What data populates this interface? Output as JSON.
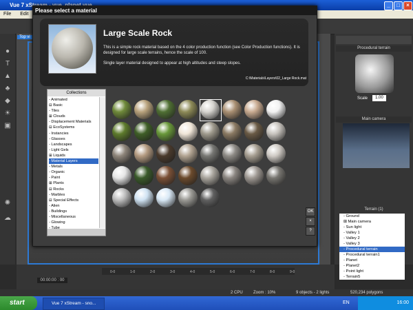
{
  "app": {
    "title": "Vue 7 xStream - vue_planet.vue",
    "controls": [
      "_",
      "□",
      "×"
    ]
  },
  "menu": {
    "items": [
      "File",
      "Edit"
    ]
  },
  "viewport": {
    "label": "Top vi"
  },
  "dialog": {
    "title": "Please select a material",
    "material": {
      "name": "Large Scale Rock",
      "description": "This is a simple rock material based on the 4 color production function (see Color Production functions). It is designed for large scale terrains, hence the scale of 100.",
      "description2": "Single layer material designed to appear at high altitudes and steep slopes.",
      "path": "C:\\Materials\\Layers\\02_Large Rock.mat"
    },
    "collections": {
      "header": "Collections",
      "items": [
        {
          "label": "- Animated"
        },
        {
          "label": "⊟ Basic"
        },
        {
          "label": "    - Tiles"
        },
        {
          "label": "⊞ Clouds"
        },
        {
          "label": "- Displacement Materials"
        },
        {
          "label": "⊟ EcoSystems"
        },
        {
          "label": "    - Instancies"
        },
        {
          "label": "- Glasses"
        },
        {
          "label": "- Landscapes"
        },
        {
          "label": "- Light Gels"
        },
        {
          "label": "⊞ Liquids"
        },
        {
          "label": "- Material Layers",
          "selected": true
        },
        {
          "label": "- Metals"
        },
        {
          "label": "- Organic"
        },
        {
          "label": "- Paint"
        },
        {
          "label": "⊞ Plants"
        },
        {
          "label": "⊟ Rocks"
        },
        {
          "label": "    - Marbles"
        },
        {
          "label": "⊟ Special Effects"
        },
        {
          "label": "    - Alien"
        },
        {
          "label": "    - Buildings"
        },
        {
          "label": "    - Miscellaneous"
        },
        {
          "label": "    - Glowing"
        },
        {
          "label": "    - Tube"
        }
      ]
    },
    "buttons": {
      "ok": "OK",
      "cancel": "×",
      "help": "?"
    }
  },
  "right_panel": {
    "object_title": "Procedural terrain",
    "scale_label": "Scale",
    "scale_value": "1.00",
    "camera_title": "Main camera",
    "terrain_count": "Terrain (1)",
    "objects": [
      {
        "label": "- Ground"
      },
      {
        "label": "⊞ Main camera"
      },
      {
        "label": "- Sun light"
      },
      {
        "label": "- Valley 1"
      },
      {
        "label": "- Valley 2"
      },
      {
        "label": "- Valley 3"
      },
      {
        "label": "- Procedural terrain",
        "selected": true
      },
      {
        "label": "- Procedural terrain1"
      },
      {
        "label": "- Planet"
      },
      {
        "label": "- Planet2"
      },
      {
        "label": "- Point light"
      },
      {
        "label": "- Terrain5"
      }
    ]
  },
  "timeline": {
    "time": "00:00:00 : 00",
    "ticks": [
      "0-0",
      "1-0",
      "2-0",
      "3-0",
      "4-0",
      "5-0",
      "6-0",
      "7-0",
      "8-0",
      "9-0"
    ]
  },
  "status": {
    "cpu": "2 CPU",
    "zoom": "Zoom : 10%",
    "objects": "9 objects - 2 lights",
    "polygons": "520,234 polygons"
  },
  "taskbar": {
    "start": "start",
    "task": "Vue 7 xStream - sno...",
    "lang": "EN",
    "clock": "16:00"
  },
  "colors": {
    "selection": "#316ac5",
    "title_blue": "#1c5fd6",
    "viewport_frame": "#2d7ad6"
  }
}
